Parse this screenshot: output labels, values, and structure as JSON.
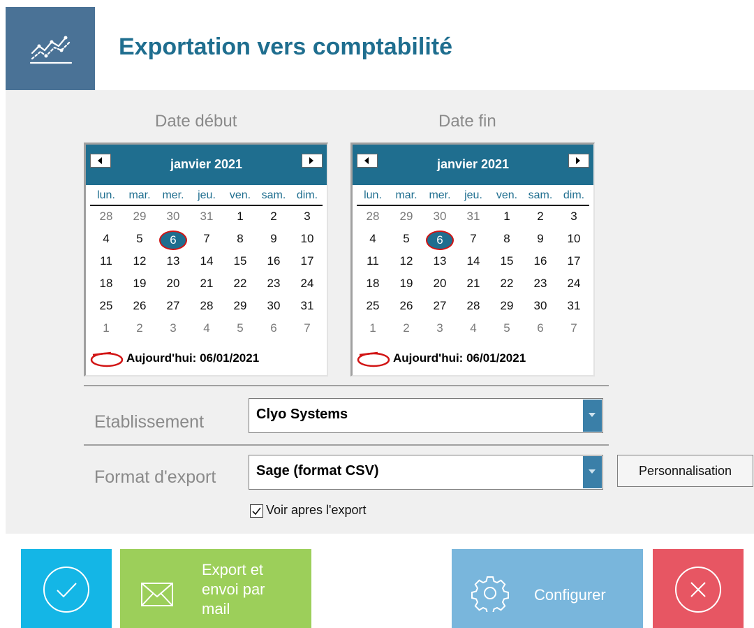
{
  "header": {
    "title": "Exportation vers comptabilité",
    "logo_icon": "chart-trend-icon",
    "logo_color": "#4a7296",
    "title_color": "#1f6e8f"
  },
  "calendars": [
    {
      "label": "Date début",
      "month": "janvier 2021",
      "weekdays": [
        "lun.",
        "mar.",
        "mer.",
        "jeu.",
        "ven.",
        "sam.",
        "dim."
      ],
      "weeks": [
        [
          "28",
          "29",
          "30",
          "31",
          "1",
          "2",
          "3"
        ],
        [
          "4",
          "5",
          "6",
          "7",
          "8",
          "9",
          "10"
        ],
        [
          "11",
          "12",
          "13",
          "14",
          "15",
          "16",
          "17"
        ],
        [
          "18",
          "19",
          "20",
          "21",
          "22",
          "23",
          "24"
        ],
        [
          "25",
          "26",
          "27",
          "28",
          "29",
          "30",
          "31"
        ],
        [
          "1",
          "2",
          "3",
          "4",
          "5",
          "6",
          "7"
        ]
      ],
      "selected": "6",
      "today": "Aujourd'hui: 06/01/2021"
    },
    {
      "label": "Date fin",
      "month": "janvier 2021",
      "weekdays": [
        "lun.",
        "mar.",
        "mer.",
        "jeu.",
        "ven.",
        "sam.",
        "dim."
      ],
      "weeks": [
        [
          "28",
          "29",
          "30",
          "31",
          "1",
          "2",
          "3"
        ],
        [
          "4",
          "5",
          "6",
          "7",
          "8",
          "9",
          "10"
        ],
        [
          "11",
          "12",
          "13",
          "14",
          "15",
          "16",
          "17"
        ],
        [
          "18",
          "19",
          "20",
          "21",
          "22",
          "23",
          "24"
        ],
        [
          "25",
          "26",
          "27",
          "28",
          "29",
          "30",
          "31"
        ],
        [
          "1",
          "2",
          "3",
          "4",
          "5",
          "6",
          "7"
        ]
      ],
      "selected": "6",
      "today": "Aujourd'hui: 06/01/2021"
    }
  ],
  "form": {
    "etablissement_label": "Etablissement",
    "etablissement_value": "Clyo Systems",
    "format_label": "Format d'export",
    "format_value": "Sage (format CSV)",
    "personnalisation_label": "Personnalisation",
    "voir_label": "Voir apres l'export",
    "voir_checked": true
  },
  "buttons": {
    "ok_icon": "check-circle-icon",
    "mail_label_lines": [
      "Export et",
      "envoi par",
      "mail"
    ],
    "mail_icon": "envelope-icon",
    "configure_label": "Configurer",
    "configure_icon": "gear-icon",
    "close_icon": "close-circle-icon",
    "colors": {
      "ok": "#14b6e6",
      "mail": "#9ccf5a",
      "configure": "#79b6dc",
      "close": "#e75663"
    }
  }
}
